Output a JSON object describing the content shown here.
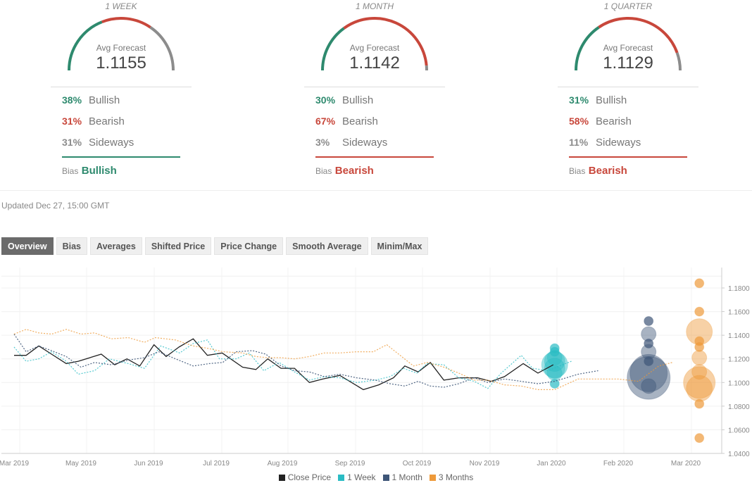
{
  "forecasts": [
    {
      "period": "1 WEEK",
      "avg_label": "Avg Forecast",
      "avg_value": "1.1155",
      "bullish_pct": "38%",
      "bullish_label": "Bullish",
      "bearish_pct": "31%",
      "bearish_label": "Bearish",
      "sideways_pct": "31%",
      "sideways_label": "Sideways",
      "bias_label": "Bias",
      "bias_value": "Bullish",
      "gauge_shares": [
        38,
        31,
        31
      ]
    },
    {
      "period": "1 MONTH",
      "avg_label": "Avg Forecast",
      "avg_value": "1.1142",
      "bullish_pct": "30%",
      "bullish_label": "Bullish",
      "bearish_pct": "67%",
      "bearish_label": "Bearish",
      "sideways_pct": "3%",
      "sideways_label": "Sideways",
      "bias_label": "Bias",
      "bias_value": "Bearish",
      "gauge_shares": [
        30,
        67,
        3
      ]
    },
    {
      "period": "1 QUARTER",
      "avg_label": "Avg Forecast",
      "avg_value": "1.1129",
      "bullish_pct": "31%",
      "bullish_label": "Bullish",
      "bearish_pct": "58%",
      "bearish_label": "Bearish",
      "sideways_pct": "11%",
      "sideways_label": "Sideways",
      "bias_label": "Bias",
      "bias_value": "Bearish",
      "gauge_shares": [
        31,
        58,
        11
      ]
    }
  ],
  "colors": {
    "bullish": "#2e8a6e",
    "bearish": "#c8473b",
    "sideways": "#8c8c8c",
    "close": "#222222",
    "week": "#2bbcc4",
    "month": "#3e5678",
    "months3": "#ee9a3a"
  },
  "updated": "Updated Dec 27, 15:00 GMT",
  "tabs": [
    "Overview",
    "Bias",
    "Averages",
    "Shifted Price",
    "Price Change",
    "Smooth Average",
    "Minim/Max"
  ],
  "active_tab": 0,
  "chart_data": {
    "type": "line",
    "title": "",
    "xlabel": "",
    "ylabel": "",
    "ylim": [
      1.04,
      1.19
    ],
    "y_ticks": [
      "1.0400",
      "1.0600",
      "1.0800",
      "1.1000",
      "1.1200",
      "1.1400",
      "1.1600",
      "1.1800"
    ],
    "x_ticks": [
      "Mar 2019",
      "May 2019",
      "Jun 2019",
      "Jul 2019",
      "Aug 2019",
      "Sep 2019",
      "Oct 2019",
      "Nov 2019",
      "Jan 2020",
      "Feb 2020",
      "Mar 2020"
    ],
    "grid": true,
    "legend": {
      "position": "bottom",
      "entries": [
        "Close Price",
        "1 Week",
        "1 Month",
        "3 Months"
      ]
    },
    "series": [
      {
        "name": "Close Price",
        "style": "solid",
        "points": [
          [
            0.0,
            1.123
          ],
          [
            0.18,
            1.123
          ],
          [
            0.37,
            1.131
          ],
          [
            0.56,
            1.124
          ],
          [
            0.78,
            1.116
          ],
          [
            0.96,
            1.118
          ],
          [
            1.3,
            1.124
          ],
          [
            1.5,
            1.115
          ],
          [
            1.68,
            1.12
          ],
          [
            1.87,
            1.114
          ],
          [
            2.08,
            1.132
          ],
          [
            2.26,
            1.122
          ],
          [
            2.45,
            1.13
          ],
          [
            2.66,
            1.137
          ],
          [
            2.87,
            1.123
          ],
          [
            3.09,
            1.125
          ],
          [
            3.4,
            1.113
          ],
          [
            3.6,
            1.111
          ],
          [
            3.78,
            1.12
          ],
          [
            3.98,
            1.112
          ],
          [
            4.18,
            1.112
          ],
          [
            4.4,
            1.1
          ],
          [
            4.6,
            1.103
          ],
          [
            4.85,
            1.106
          ],
          [
            5.2,
            1.094
          ],
          [
            5.43,
            1.098
          ],
          [
            5.65,
            1.104
          ],
          [
            5.82,
            1.114
          ],
          [
            6.02,
            1.109
          ],
          [
            6.2,
            1.117
          ],
          [
            6.4,
            1.102
          ],
          [
            6.62,
            1.104
          ],
          [
            6.9,
            1.104
          ],
          [
            7.1,
            1.101
          ],
          [
            7.3,
            1.105
          ],
          [
            7.58,
            1.116
          ],
          [
            7.8,
            1.108
          ],
          [
            8.03,
            1.115
          ]
        ]
      },
      {
        "name": "1 Week",
        "style": "dashed",
        "points": [
          [
            0.0,
            1.13
          ],
          [
            0.18,
            1.118
          ],
          [
            0.37,
            1.12
          ],
          [
            0.56,
            1.126
          ],
          [
            0.78,
            1.118
          ],
          [
            0.96,
            1.107
          ],
          [
            1.2,
            1.11
          ],
          [
            1.42,
            1.12
          ],
          [
            1.7,
            1.116
          ],
          [
            1.94,
            1.112
          ],
          [
            2.18,
            1.131
          ],
          [
            2.46,
            1.125
          ],
          [
            2.66,
            1.133
          ],
          [
            2.87,
            1.136
          ],
          [
            3.05,
            1.12
          ],
          [
            3.3,
            1.12
          ],
          [
            3.5,
            1.125
          ],
          [
            3.72,
            1.11
          ],
          [
            3.95,
            1.117
          ],
          [
            4.18,
            1.109
          ],
          [
            4.4,
            1.102
          ],
          [
            4.62,
            1.105
          ],
          [
            4.85,
            1.104
          ],
          [
            5.1,
            1.1
          ],
          [
            5.38,
            1.102
          ],
          [
            5.6,
            1.105
          ],
          [
            5.8,
            1.112
          ],
          [
            6.0,
            1.108
          ],
          [
            6.15,
            1.116
          ],
          [
            6.4,
            1.115
          ],
          [
            6.62,
            1.104
          ],
          [
            6.85,
            1.101
          ],
          [
            7.05,
            1.095
          ],
          [
            7.25,
            1.108
          ],
          [
            7.55,
            1.123
          ],
          [
            7.72,
            1.112
          ],
          [
            7.95,
            1.11
          ],
          [
            8.3,
            1.118
          ]
        ]
      },
      {
        "name": "1 Month",
        "style": "dashed",
        "points": [
          [
            0.0,
            1.141
          ],
          [
            0.18,
            1.126
          ],
          [
            0.37,
            1.131
          ],
          [
            0.56,
            1.127
          ],
          [
            0.78,
            1.122
          ],
          [
            1.0,
            1.113
          ],
          [
            1.2,
            1.117
          ],
          [
            1.45,
            1.115
          ],
          [
            1.7,
            1.119
          ],
          [
            1.94,
            1.121
          ],
          [
            2.15,
            1.126
          ],
          [
            2.4,
            1.12
          ],
          [
            2.66,
            1.114
          ],
          [
            2.9,
            1.116
          ],
          [
            3.1,
            1.117
          ],
          [
            3.3,
            1.126
          ],
          [
            3.55,
            1.127
          ],
          [
            3.75,
            1.124
          ],
          [
            3.98,
            1.114
          ],
          [
            4.18,
            1.11
          ],
          [
            4.4,
            1.109
          ],
          [
            4.62,
            1.105
          ],
          [
            4.85,
            1.107
          ],
          [
            5.1,
            1.104
          ],
          [
            5.38,
            1.102
          ],
          [
            5.6,
            1.099
          ],
          [
            5.82,
            1.097
          ],
          [
            6.02,
            1.101
          ],
          [
            6.2,
            1.097
          ],
          [
            6.4,
            1.096
          ],
          [
            6.62,
            1.099
          ],
          [
            6.85,
            1.104
          ],
          [
            7.05,
            1.1
          ],
          [
            7.3,
            1.103
          ],
          [
            7.55,
            1.101
          ],
          [
            7.8,
            1.099
          ],
          [
            8.05,
            1.101
          ],
          [
            8.4,
            1.107
          ],
          [
            8.7,
            1.11
          ]
        ]
      },
      {
        "name": "3 Months",
        "style": "dashed",
        "points": [
          [
            0.0,
            1.141
          ],
          [
            0.18,
            1.145
          ],
          [
            0.37,
            1.142
          ],
          [
            0.56,
            1.141
          ],
          [
            0.78,
            1.145
          ],
          [
            1.0,
            1.141
          ],
          [
            1.2,
            1.142
          ],
          [
            1.45,
            1.137
          ],
          [
            1.7,
            1.138
          ],
          [
            1.94,
            1.134
          ],
          [
            2.1,
            1.138
          ],
          [
            2.4,
            1.136
          ],
          [
            2.66,
            1.131
          ],
          [
            2.87,
            1.129
          ],
          [
            3.1,
            1.126
          ],
          [
            3.4,
            1.125
          ],
          [
            3.6,
            1.122
          ],
          [
            3.78,
            1.121
          ],
          [
            3.98,
            1.121
          ],
          [
            4.18,
            1.12
          ],
          [
            4.4,
            1.122
          ],
          [
            4.62,
            1.125
          ],
          [
            4.85,
            1.125
          ],
          [
            5.1,
            1.126
          ],
          [
            5.35,
            1.126
          ],
          [
            5.55,
            1.132
          ],
          [
            5.75,
            1.123
          ],
          [
            5.95,
            1.114
          ],
          [
            6.15,
            1.117
          ],
          [
            6.4,
            1.113
          ],
          [
            6.62,
            1.108
          ],
          [
            6.85,
            1.102
          ],
          [
            7.05,
            1.102
          ],
          [
            7.3,
            1.098
          ],
          [
            7.55,
            1.097
          ],
          [
            7.8,
            1.094
          ],
          [
            8.05,
            1.094
          ],
          [
            8.4,
            1.103
          ],
          [
            8.7,
            1.103
          ],
          [
            9.0,
            1.103
          ],
          [
            9.3,
            1.101
          ],
          [
            9.6,
            1.114
          ],
          [
            9.8,
            1.117
          ]
        ]
      }
    ],
    "bubbles": [
      {
        "series": "1 Week",
        "x": 8.05,
        "points": [
          [
            1.129,
            1
          ],
          [
            1.126,
            1
          ],
          [
            1.121,
            2
          ],
          [
            1.118,
            3
          ],
          [
            1.115,
            4
          ],
          [
            1.112,
            3
          ],
          [
            1.108,
            2
          ],
          [
            1.099,
            1
          ]
        ]
      },
      {
        "series": "1 Month",
        "x": 9.45,
        "points": [
          [
            1.152,
            1
          ],
          [
            1.141,
            2
          ],
          [
            1.133,
            1
          ],
          [
            1.126,
            2
          ],
          [
            1.118,
            1
          ],
          [
            1.108,
            6
          ],
          [
            1.104,
            7
          ],
          [
            1.097,
            2
          ]
        ]
      },
      {
        "series": "3 Months",
        "x": 10.2,
        "points": [
          [
            1.184,
            1
          ],
          [
            1.16,
            1
          ],
          [
            1.143,
            4
          ],
          [
            1.135,
            1
          ],
          [
            1.13,
            1
          ],
          [
            1.121,
            2
          ],
          [
            1.109,
            2
          ],
          [
            1.1,
            5
          ],
          [
            1.095,
            4
          ],
          [
            1.082,
            1
          ],
          [
            1.053,
            1
          ]
        ]
      }
    ]
  }
}
